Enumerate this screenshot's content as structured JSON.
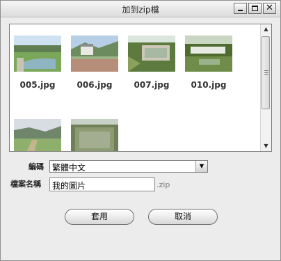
{
  "window": {
    "title": "加到zip檔"
  },
  "titlebar_buttons": {
    "minimize_icon": "minimize-icon",
    "maximize_icon": "maximize-icon",
    "close_icon": "close-icon"
  },
  "gallery": {
    "items": [
      {
        "label": "005.jpg"
      },
      {
        "label": "006.jpg"
      },
      {
        "label": "007.jpg"
      },
      {
        "label": "010.jpg"
      },
      {
        "label": ""
      },
      {
        "label": ""
      }
    ]
  },
  "form": {
    "encoding_label": "編碼",
    "encoding_value": "繁體中文",
    "filename_label": "檔案名稱",
    "filename_value": "我的圖片",
    "extension": ".zip"
  },
  "buttons": {
    "apply": "套用",
    "cancel": "取消"
  }
}
